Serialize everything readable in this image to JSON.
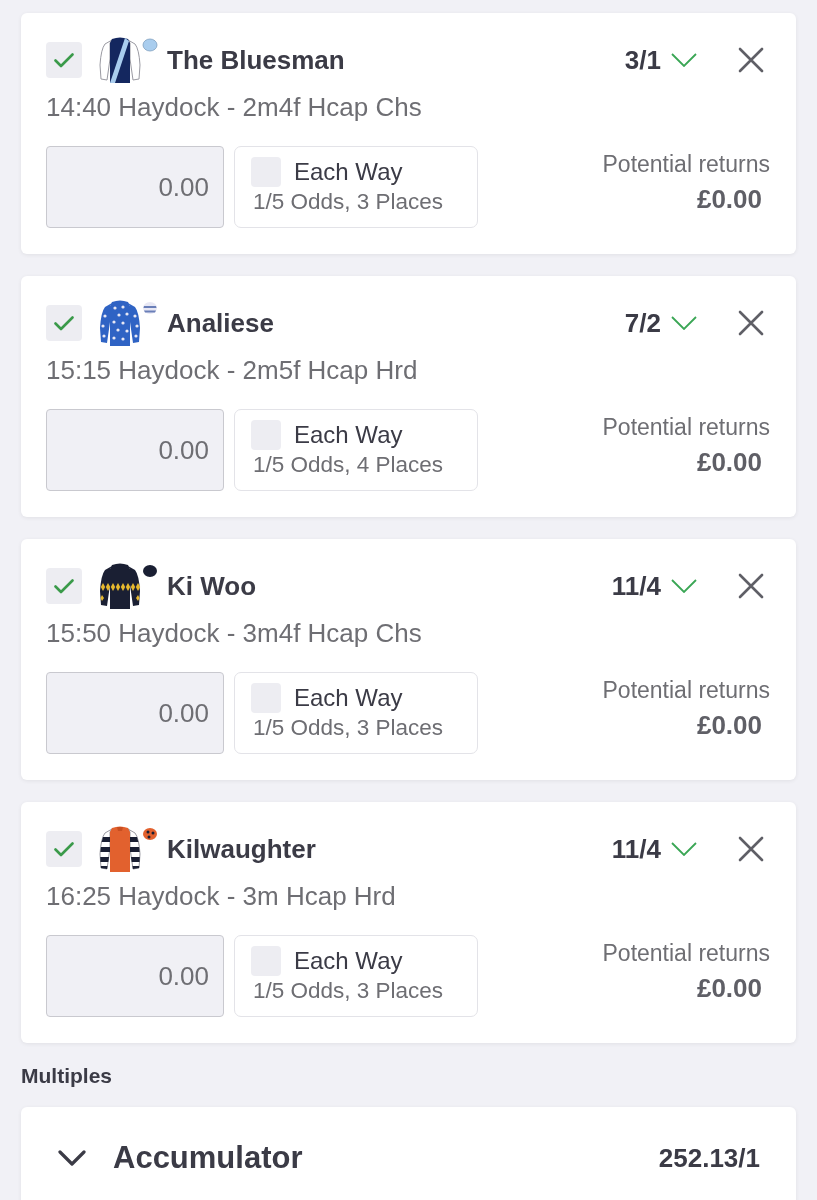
{
  "selections": [
    {
      "kind": "sash",
      "checked": true,
      "name": "The Bluesman",
      "odds": "3/1",
      "event": "14:40 Haydock - 2m4f Hcap Chs",
      "stake": {
        "placeholder": "0.00"
      },
      "each_way": {
        "checked": false,
        "label": "Each Way",
        "terms": "1/5 Odds, 3 Places"
      },
      "returns_label": "Potential returns",
      "returns": "£0.00"
    },
    {
      "kind": "stars",
      "checked": true,
      "name": "Analiese",
      "odds": "7/2",
      "event": "15:15 Haydock - 2m5f Hcap Hrd",
      "stake": {
        "placeholder": "0.00"
      },
      "each_way": {
        "checked": false,
        "label": "Each Way",
        "terms": "1/5 Odds, 4 Places"
      },
      "returns_label": "Potential returns",
      "returns": "£0.00"
    },
    {
      "kind": "diamonds",
      "checked": true,
      "name": "Ki Woo",
      "odds": "11/4",
      "event": "15:50 Haydock - 3m4f Hcap Chs",
      "stake": {
        "placeholder": "0.00"
      },
      "each_way": {
        "checked": false,
        "label": "Each Way",
        "terms": "1/5 Odds, 3 Places"
      },
      "returns_label": "Potential returns",
      "returns": "£0.00"
    },
    {
      "kind": "hooped-sleeves",
      "checked": true,
      "name": "Kilwaughter",
      "odds": "11/4",
      "event": "16:25 Haydock - 3m Hcap Hrd",
      "stake": {
        "placeholder": "0.00"
      },
      "each_way": {
        "checked": false,
        "label": "Each Way",
        "terms": "1/5 Odds, 3 Places"
      },
      "returns_label": "Potential returns",
      "returns": "£0.00"
    }
  ],
  "multiples": {
    "title": "Multiples",
    "items": [
      {
        "name": "Accumulator",
        "odds": "252.13/1"
      }
    ]
  }
}
